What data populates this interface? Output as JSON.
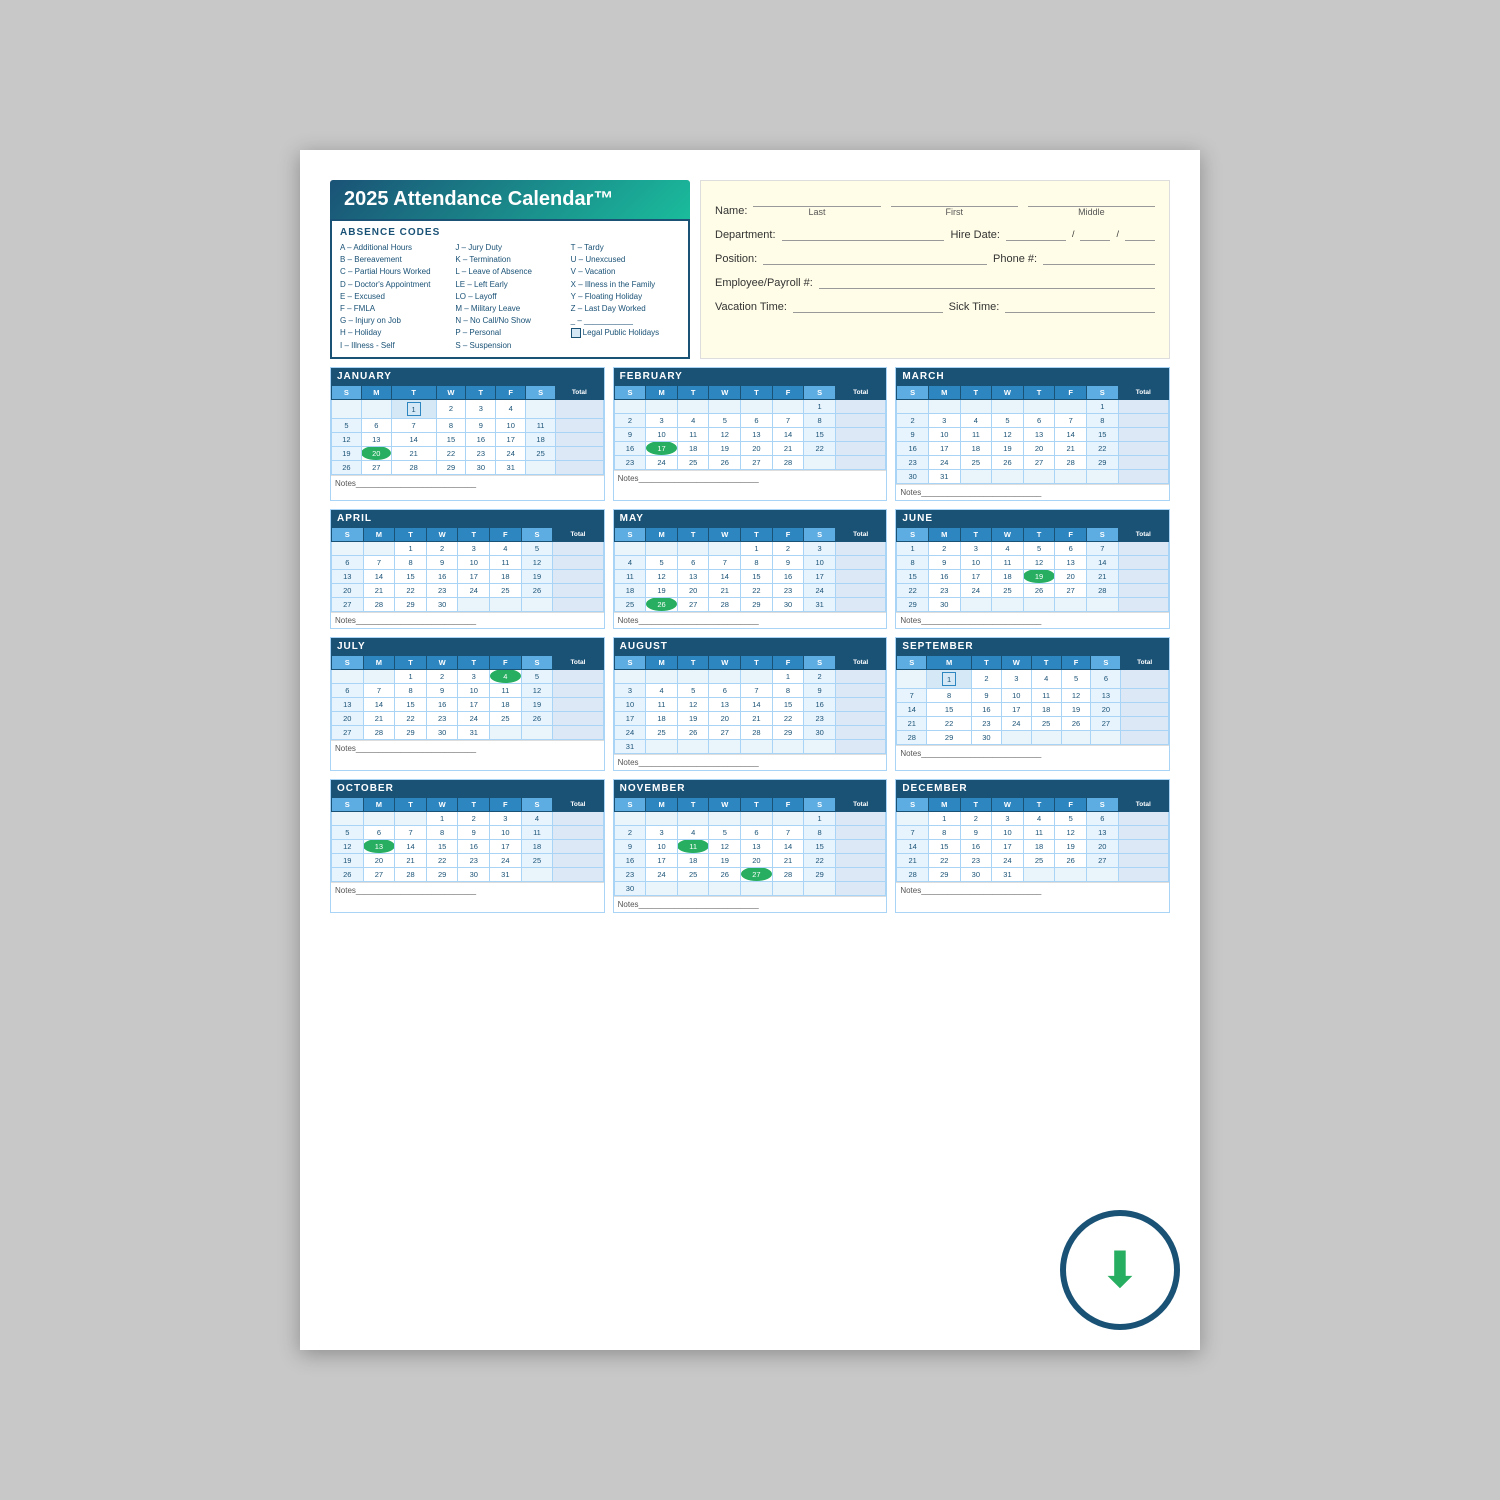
{
  "title": "2025 Attendance Calendar™",
  "absence_codes": {
    "title": "ABSENCE CODES",
    "col1": [
      "A – Additional Hours",
      "B – Bereavement",
      "C – Partial Hours Worked",
      "D – Doctor's Appointment",
      "E – Excused",
      "F – FMLA",
      "G – Injury on Job",
      "H – Holiday",
      "I  – Illness - Self"
    ],
    "col2": [
      "J  – Jury Duty",
      "K – Termination",
      "L  – Leave of Absence",
      "LE – Left Early",
      "LO – Layoff",
      "M – Military Leave",
      "N – No Call/No Show",
      "P  – Personal",
      "S  – Suspension"
    ],
    "col3": [
      "T – Tardy",
      "U – Unexcused",
      "V – Vacation",
      "X – Illness in the Family",
      "Y – Floating Holiday",
      "Z – Last Day Worked",
      "_ – ___________",
      "= Legal Public Holidays",
      ""
    ]
  },
  "employee_info": {
    "name_label": "Name:",
    "last_label": "Last",
    "first_label": "First",
    "middle_label": "Middle",
    "dept_label": "Department:",
    "hire_label": "Hire Date:",
    "position_label": "Position:",
    "phone_label": "Phone #:",
    "emp_label": "Employee/Payroll #:",
    "vacation_label": "Vacation Time:",
    "sick_label": "Sick Time:"
  },
  "months": [
    {
      "name": "JANUARY",
      "days": [
        [
          "",
          "",
          "1",
          "2",
          "3",
          "4",
          ""
        ],
        [
          "5",
          "6",
          "7",
          "8",
          "9",
          "10",
          "11"
        ],
        [
          "12",
          "13",
          "14",
          "15",
          "16",
          "17",
          "18"
        ],
        [
          "19",
          "20",
          "21",
          "22",
          "23",
          "24",
          "25"
        ],
        [
          "26",
          "27",
          "28",
          "29",
          "30",
          "31",
          ""
        ]
      ],
      "highlights": [
        "1"
      ],
      "green_cells": [
        "20"
      ]
    },
    {
      "name": "FEBRUARY",
      "days": [
        [
          "",
          "",
          "",
          "",
          "",
          "",
          "1"
        ],
        [
          "2",
          "3",
          "4",
          "5",
          "6",
          "7",
          "8"
        ],
        [
          "9",
          "10",
          "11",
          "12",
          "13",
          "14",
          "15"
        ],
        [
          "16",
          "17",
          "18",
          "19",
          "20",
          "21",
          "22"
        ],
        [
          "23",
          "24",
          "25",
          "26",
          "27",
          "28",
          ""
        ]
      ],
      "highlights": [],
      "green_cells": [
        "17"
      ]
    },
    {
      "name": "MARCH",
      "days": [
        [
          "",
          "",
          "",
          "",
          "",
          "",
          "1"
        ],
        [
          "2",
          "3",
          "4",
          "5",
          "6",
          "7",
          "8"
        ],
        [
          "9",
          "10",
          "11",
          "12",
          "13",
          "14",
          "15"
        ],
        [
          "16",
          "17",
          "18",
          "19",
          "20",
          "21",
          "22"
        ],
        [
          "23",
          "24",
          "25",
          "26",
          "27",
          "28",
          "29"
        ],
        [
          "30",
          "31",
          "",
          "",
          "",
          "",
          ""
        ]
      ],
      "highlights": [],
      "green_cells": []
    },
    {
      "name": "APRIL",
      "days": [
        [
          "",
          "",
          "1",
          "2",
          "3",
          "4",
          "5"
        ],
        [
          "6",
          "7",
          "8",
          "9",
          "10",
          "11",
          "12"
        ],
        [
          "13",
          "14",
          "15",
          "16",
          "17",
          "18",
          "19"
        ],
        [
          "20",
          "21",
          "22",
          "23",
          "24",
          "25",
          "26"
        ],
        [
          "27",
          "28",
          "29",
          "30",
          "",
          "",
          ""
        ]
      ],
      "highlights": [],
      "green_cells": []
    },
    {
      "name": "MAY",
      "days": [
        [
          "",
          "",
          "",
          "",
          "1",
          "2",
          "3"
        ],
        [
          "4",
          "5",
          "6",
          "7",
          "8",
          "9",
          "10"
        ],
        [
          "11",
          "12",
          "13",
          "14",
          "15",
          "16",
          "17"
        ],
        [
          "18",
          "19",
          "20",
          "21",
          "22",
          "23",
          "24"
        ],
        [
          "25",
          "26",
          "27",
          "28",
          "29",
          "30",
          "31"
        ]
      ],
      "highlights": [],
      "green_cells": [
        "26"
      ]
    },
    {
      "name": "JUNE",
      "days": [
        [
          "1",
          "2",
          "3",
          "4",
          "5",
          "6",
          "7"
        ],
        [
          "8",
          "9",
          "10",
          "11",
          "12",
          "13",
          "14"
        ],
        [
          "15",
          "16",
          "17",
          "18",
          "19",
          "20",
          "21"
        ],
        [
          "22",
          "23",
          "24",
          "25",
          "26",
          "27",
          "28"
        ],
        [
          "29",
          "30",
          "",
          "",
          "",
          "",
          ""
        ]
      ],
      "highlights": [],
      "green_cells": [
        "19"
      ]
    },
    {
      "name": "JULY",
      "days": [
        [
          "",
          "",
          "1",
          "2",
          "3",
          "4",
          "5"
        ],
        [
          "6",
          "7",
          "8",
          "9",
          "10",
          "11",
          "12"
        ],
        [
          "13",
          "14",
          "15",
          "16",
          "17",
          "18",
          "19"
        ],
        [
          "20",
          "21",
          "22",
          "23",
          "24",
          "25",
          "26"
        ],
        [
          "27",
          "28",
          "29",
          "30",
          "31",
          "",
          ""
        ]
      ],
      "highlights": [],
      "green_cells": [
        "4"
      ]
    },
    {
      "name": "AUGUST",
      "days": [
        [
          "",
          "",
          "",
          "",
          "",
          "1",
          "2"
        ],
        [
          "3",
          "4",
          "5",
          "6",
          "7",
          "8",
          "9"
        ],
        [
          "10",
          "11",
          "12",
          "13",
          "14",
          "15",
          "16"
        ],
        [
          "17",
          "18",
          "19",
          "20",
          "21",
          "22",
          "23"
        ],
        [
          "24",
          "25",
          "26",
          "27",
          "28",
          "29",
          "30"
        ],
        [
          "31",
          "",
          "",
          "",
          "",
          "",
          ""
        ]
      ],
      "highlights": [],
      "green_cells": []
    },
    {
      "name": "SEPTEMBER",
      "days": [
        [
          "",
          "1",
          "2",
          "3",
          "4",
          "5",
          "6"
        ],
        [
          "7",
          "8",
          "9",
          "10",
          "11",
          "12",
          "13"
        ],
        [
          "14",
          "15",
          "16",
          "17",
          "18",
          "19",
          "20"
        ],
        [
          "21",
          "22",
          "23",
          "24",
          "25",
          "26",
          "27"
        ],
        [
          "28",
          "29",
          "30",
          "",
          "",
          "",
          ""
        ]
      ],
      "highlights": [
        "1"
      ],
      "green_cells": []
    },
    {
      "name": "OCTOBER",
      "days": [
        [
          "",
          "",
          "",
          "1",
          "2",
          "3",
          "4"
        ],
        [
          "5",
          "6",
          "7",
          "8",
          "9",
          "10",
          "11"
        ],
        [
          "12",
          "13",
          "14",
          "15",
          "16",
          "17",
          "18"
        ],
        [
          "19",
          "20",
          "21",
          "22",
          "23",
          "24",
          "25"
        ],
        [
          "26",
          "27",
          "28",
          "29",
          "30",
          "31",
          ""
        ]
      ],
      "highlights": [],
      "green_cells": [
        "13"
      ]
    },
    {
      "name": "NOVEMBER",
      "days": [
        [
          "",
          "",
          "",
          "",
          "",
          "",
          "1"
        ],
        [
          "2",
          "3",
          "4",
          "5",
          "6",
          "7",
          "8"
        ],
        [
          "9",
          "10",
          "11",
          "12",
          "13",
          "14",
          "15"
        ],
        [
          "16",
          "17",
          "18",
          "19",
          "20",
          "21",
          "22"
        ],
        [
          "23",
          "24",
          "25",
          "26",
          "27",
          "28",
          "29"
        ],
        [
          "30",
          "",
          "",
          "",
          "",
          "",
          ""
        ]
      ],
      "highlights": [],
      "green_cells": [
        "11",
        "27"
      ]
    },
    {
      "name": "DECEMBER",
      "days": [
        [
          "",
          "1",
          "2",
          "3",
          "4",
          "5",
          "6"
        ],
        [
          "7",
          "8",
          "9",
          "10",
          "11",
          "12",
          "13"
        ],
        [
          "14",
          "15",
          "16",
          "17",
          "18",
          "19",
          "20"
        ],
        [
          "21",
          "22",
          "23",
          "24",
          "25",
          "26",
          "27"
        ],
        [
          "28",
          "29",
          "30",
          "31",
          "",
          "",
          ""
        ]
      ],
      "highlights": [],
      "green_cells": []
    }
  ],
  "days_header": [
    "S",
    "M",
    "T",
    "W",
    "T",
    "F",
    "S",
    "Total"
  ],
  "notes_label": "Notes",
  "download_icon": "⬇"
}
